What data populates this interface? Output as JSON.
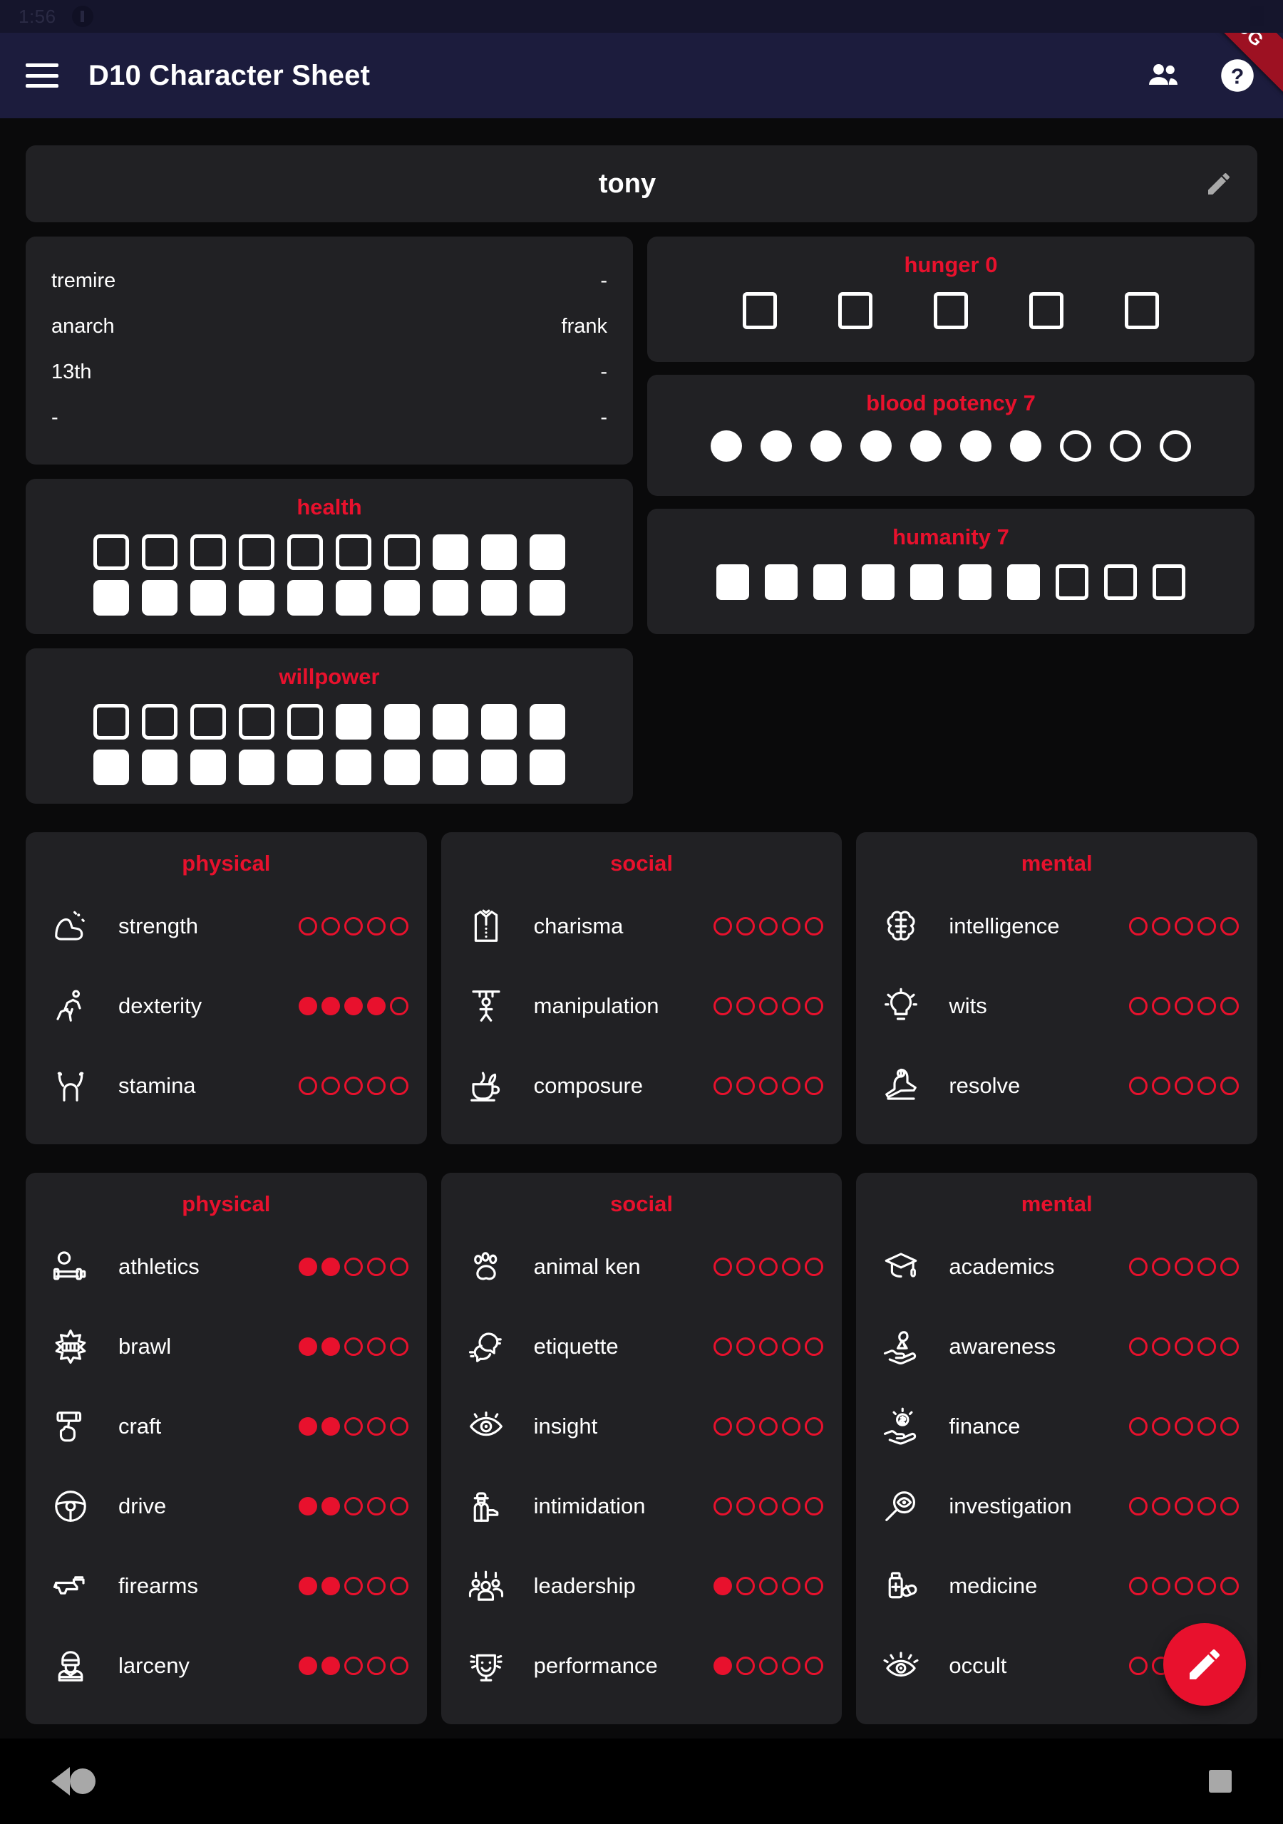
{
  "statusbar": {
    "time": "1:56"
  },
  "appbar": {
    "title": "D10 Character Sheet",
    "menu_icon": "hamburger-menu-icon",
    "people_icon": "people-icon",
    "help_icon": "help-circle-icon",
    "debug_ribbon": "DEBUG"
  },
  "name_card": {
    "character_name": "tony",
    "edit_icon": "pencil-icon"
  },
  "info": {
    "rows": [
      {
        "key": "tremire",
        "value": "-"
      },
      {
        "key": "anarch",
        "value": "frank"
      },
      {
        "key": "13th",
        "value": "-"
      },
      {
        "key": "-",
        "value": "-"
      }
    ]
  },
  "health": {
    "title": "health",
    "row1": [
      "empty",
      "empty",
      "empty",
      "empty",
      "empty",
      "empty",
      "empty",
      "full",
      "full",
      "full"
    ],
    "row2": [
      "full",
      "full",
      "full",
      "full",
      "full",
      "full",
      "full",
      "full",
      "full",
      "full"
    ]
  },
  "willpower": {
    "title": "willpower",
    "row1": [
      "empty",
      "empty",
      "empty",
      "empty",
      "empty",
      "full",
      "full",
      "full",
      "full",
      "full"
    ],
    "row2": [
      "full",
      "full",
      "full",
      "full",
      "full",
      "full",
      "full",
      "full",
      "full",
      "full"
    ]
  },
  "hunger": {
    "title": "hunger 0",
    "value": 0,
    "boxes": [
      "empty",
      "empty",
      "empty",
      "empty",
      "empty"
    ]
  },
  "blood_potency": {
    "title": "blood potency 7",
    "value": 7,
    "dots": [
      "full",
      "full",
      "full",
      "full",
      "full",
      "full",
      "full",
      "empty",
      "empty",
      "empty"
    ]
  },
  "humanity": {
    "title": "humanity 7",
    "value": 7,
    "boxes": [
      "full",
      "full",
      "full",
      "full",
      "full",
      "full",
      "full",
      "empty",
      "empty",
      "empty"
    ]
  },
  "attributes": [
    {
      "title": "physical",
      "traits": [
        {
          "icon": "flexed-bicep-icon",
          "label": "strength",
          "value": 0,
          "max": 5
        },
        {
          "icon": "running-person-icon",
          "label": "dexterity",
          "value": 4,
          "max": 5
        },
        {
          "icon": "raised-arms-icon",
          "label": "stamina",
          "value": 0,
          "max": 5
        }
      ]
    },
    {
      "title": "social",
      "traits": [
        {
          "icon": "suit-vest-icon",
          "label": "charisma",
          "value": 0,
          "max": 5
        },
        {
          "icon": "puppet-icon",
          "label": "manipulation",
          "value": 0,
          "max": 5
        },
        {
          "icon": "tea-cup-icon",
          "label": "composure",
          "value": 0,
          "max": 5
        }
      ]
    },
    {
      "title": "mental",
      "traits": [
        {
          "icon": "brain-circuit-icon",
          "label": "intelligence",
          "value": 0,
          "max": 5
        },
        {
          "icon": "lightbulb-icon",
          "label": "wits",
          "value": 0,
          "max": 5
        },
        {
          "icon": "meditation-icon",
          "label": "resolve",
          "value": 0,
          "max": 5
        }
      ]
    }
  ],
  "skills": [
    {
      "title": "physical",
      "traits": [
        {
          "icon": "dumbbell-icon",
          "label": "athletics",
          "value": 2,
          "max": 5
        },
        {
          "icon": "punch-impact-icon",
          "label": "brawl",
          "value": 2,
          "max": 5
        },
        {
          "icon": "hammer-hand-icon",
          "label": "craft",
          "value": 2,
          "max": 5
        },
        {
          "icon": "steering-wheel-icon",
          "label": "drive",
          "value": 2,
          "max": 5
        },
        {
          "icon": "pistol-icon",
          "label": "firearms",
          "value": 2,
          "max": 5
        },
        {
          "icon": "burglar-icon",
          "label": "larceny",
          "value": 2,
          "max": 5
        }
      ]
    },
    {
      "title": "social",
      "traits": [
        {
          "icon": "paw-print-icon",
          "label": "animal ken",
          "value": 0,
          "max": 5
        },
        {
          "icon": "two-heads-talking-icon",
          "label": "etiquette",
          "value": 0,
          "max": 5
        },
        {
          "icon": "eye-icon",
          "label": "insight",
          "value": 0,
          "max": 5
        },
        {
          "icon": "gangster-icon",
          "label": "intimidation",
          "value": 0,
          "max": 5
        },
        {
          "icon": "crowd-icon",
          "label": "leadership",
          "value": 1,
          "max": 5
        },
        {
          "icon": "theater-mask-icon",
          "label": "performance",
          "value": 1,
          "max": 5
        }
      ]
    },
    {
      "title": "mental",
      "traits": [
        {
          "icon": "graduation-cap-icon",
          "label": "academics",
          "value": 0,
          "max": 5
        },
        {
          "icon": "hand-ribbon-icon",
          "label": "awareness",
          "value": 0,
          "max": 5
        },
        {
          "icon": "hand-coin-icon",
          "label": "finance",
          "value": 0,
          "max": 5
        },
        {
          "icon": "magnifier-eye-icon",
          "label": "investigation",
          "value": 0,
          "max": 5
        },
        {
          "icon": "medicine-bottle-icon",
          "label": "medicine",
          "value": 0,
          "max": 5
        },
        {
          "icon": "mystic-eye-icon",
          "label": "occult",
          "value": 0,
          "max": 5
        }
      ]
    }
  ],
  "fab": {
    "icon": "pencil-icon"
  },
  "navbar": {
    "back": "back-triangle-icon",
    "home": "home-circle-icon",
    "recents": "recents-square-icon"
  },
  "colors": {
    "accent": "#e8112d",
    "appbar": "#1c1c3d",
    "panel": "#212124",
    "background": "#0a0a0b"
  }
}
